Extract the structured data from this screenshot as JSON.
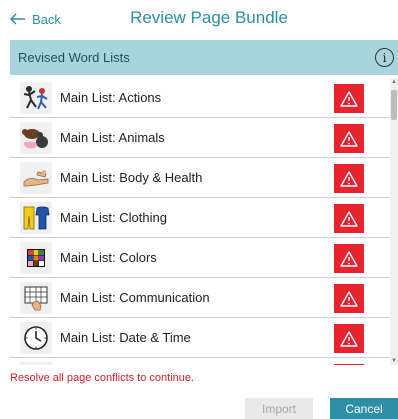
{
  "header": {
    "back_label": "Back",
    "title": "Review Page Bundle"
  },
  "section": {
    "title": "Revised Word Lists",
    "info_glyph": "i"
  },
  "items": [
    {
      "label": "Main List: Actions",
      "icon": "actions-icon"
    },
    {
      "label": "Main List: Animals",
      "icon": "animals-icon"
    },
    {
      "label": "Main List: Body & Health",
      "icon": "body-health-icon"
    },
    {
      "label": "Main List: Clothing",
      "icon": "clothing-icon"
    },
    {
      "label": "Main List: Colors",
      "icon": "colors-icon"
    },
    {
      "label": "Main List: Communication",
      "icon": "communication-icon"
    },
    {
      "label": "Main List: Date & Time",
      "icon": "clock-icon"
    },
    {
      "label": "",
      "icon": "partial-item-icon"
    }
  ],
  "error_message": "Resolve all page conflicts to continue.",
  "buttons": {
    "import_label": "Import",
    "cancel_label": "Cancel"
  },
  "colors": {
    "accent": "#2a8fa3",
    "header_bg": "#a9d4de",
    "warning": "#e8232e",
    "error_text": "#d0202b"
  }
}
